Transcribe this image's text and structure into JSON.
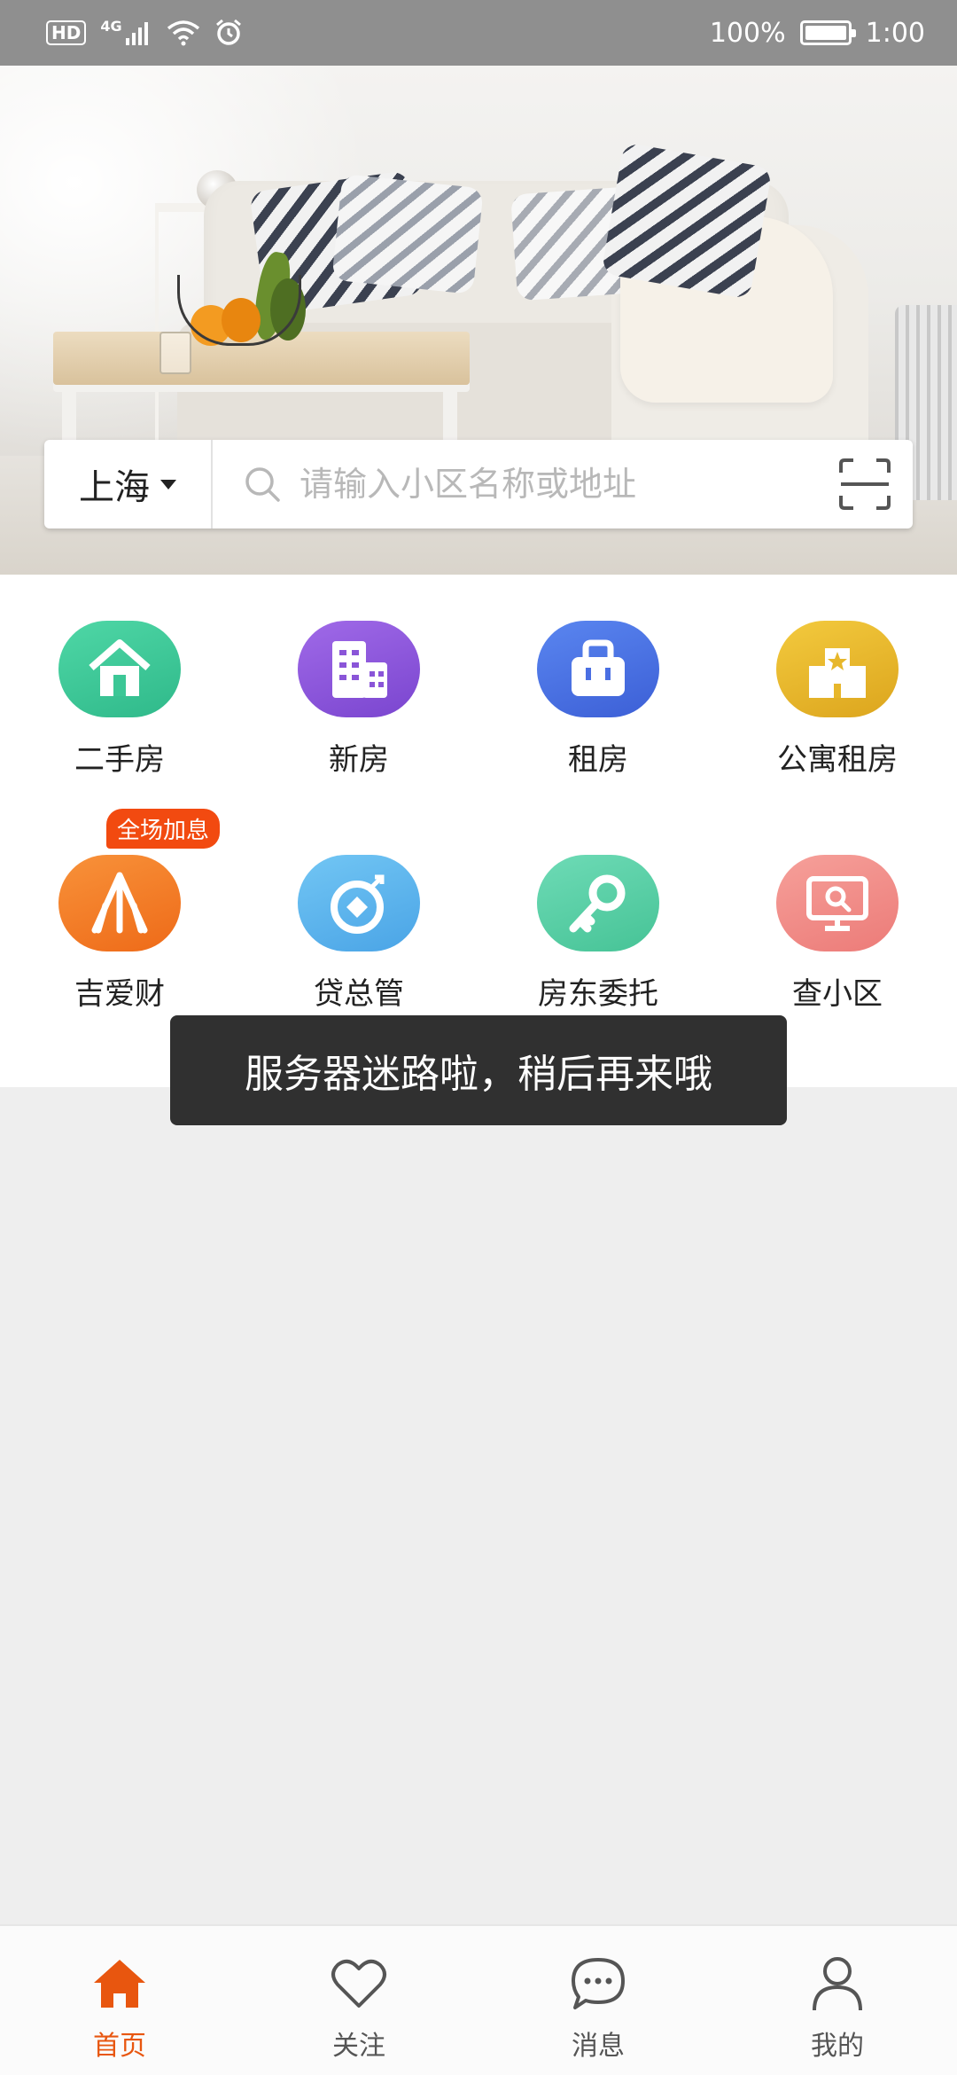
{
  "status_bar": {
    "hd": "HD",
    "network": "4G",
    "battery": "100%",
    "time": "1:00",
    "icons": [
      "hd-icon",
      "signal-icon",
      "wifi-icon",
      "alarm-icon",
      "battery-icon"
    ]
  },
  "search": {
    "city": "上海",
    "placeholder": "请输入小区名称或地址"
  },
  "menu": {
    "items": [
      {
        "label": "二手房",
        "icon": "house-icon",
        "color": "#3cc796"
      },
      {
        "label": "新房",
        "icon": "building-icon",
        "color": "#8a55d8"
      },
      {
        "label": "租房",
        "icon": "bag-icon",
        "color": "#4a6fe3"
      },
      {
        "label": "公寓租房",
        "icon": "apartment-icon",
        "color": "#e7b72b"
      },
      {
        "label": "吉爱财",
        "icon": "finance-icon",
        "color": "#f47a24",
        "badge": "全场加息"
      },
      {
        "label": "贷总管",
        "icon": "loan-icon",
        "color": "#5ab5ee"
      },
      {
        "label": "房东委托",
        "icon": "key-icon",
        "color": "#58cfa7"
      },
      {
        "label": "查小区",
        "icon": "monitor-search-icon",
        "color": "#f08a86"
      }
    ]
  },
  "toast": {
    "message": "服务器迷路啦，稍后再来哦"
  },
  "bottom_nav": {
    "items": [
      {
        "label": "首页",
        "icon": "home-icon",
        "active": true
      },
      {
        "label": "关注",
        "icon": "heart-icon",
        "active": false
      },
      {
        "label": "消息",
        "icon": "chat-icon",
        "active": false
      },
      {
        "label": "我的",
        "icon": "person-icon",
        "active": false
      }
    ]
  },
  "colors": {
    "accent": "#e8560f",
    "background": "#eeeeee",
    "status_bar": "#8f8f8f",
    "toast": "#303030"
  }
}
